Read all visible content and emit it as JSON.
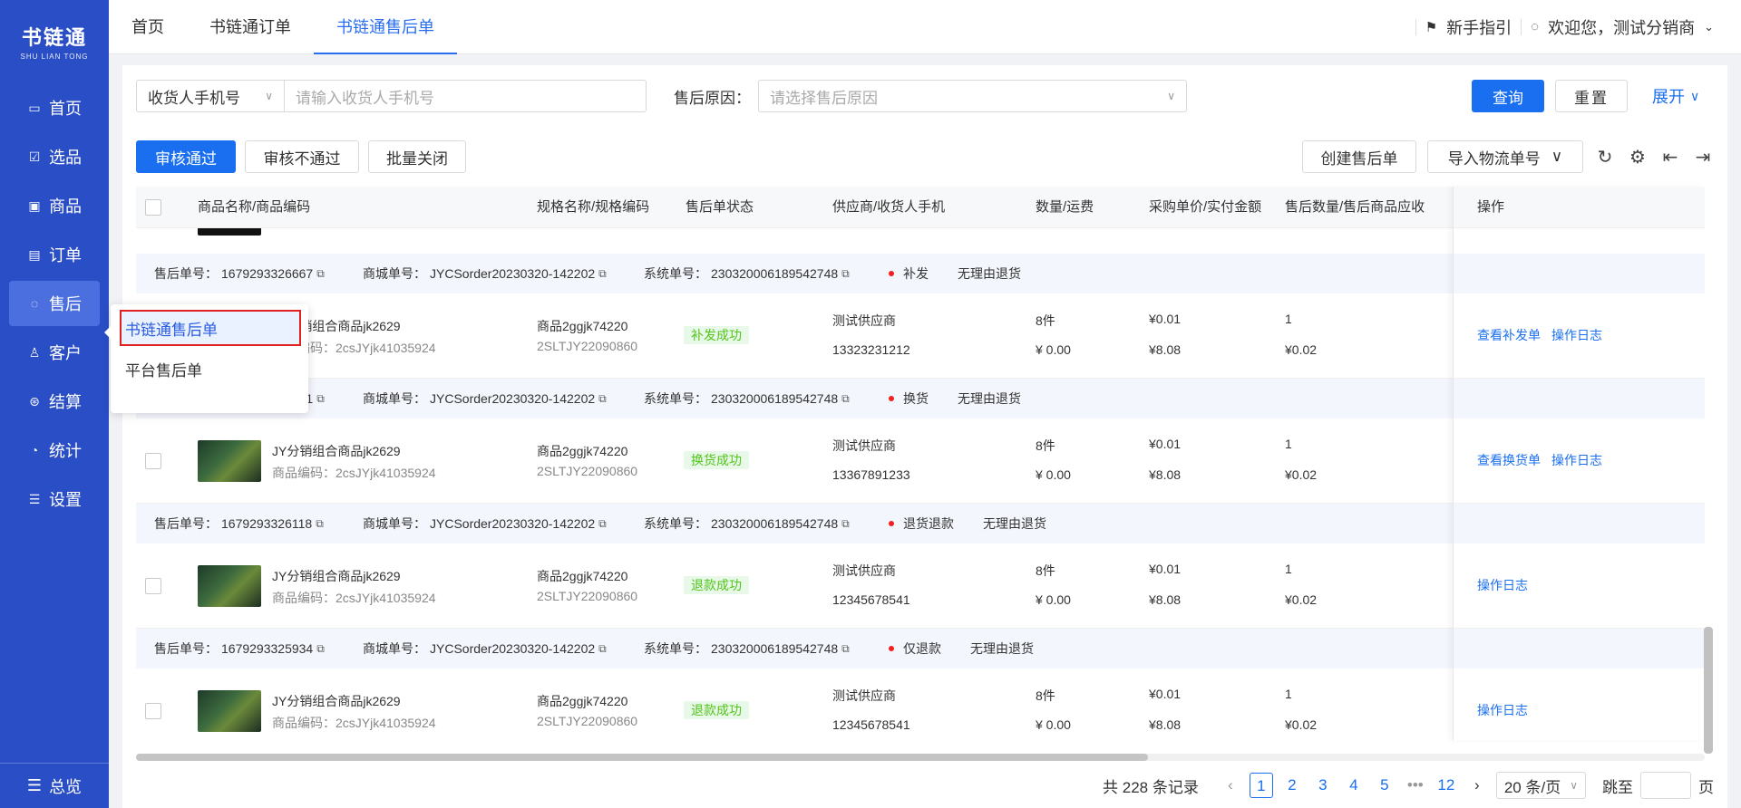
{
  "brand": {
    "name": "书链通",
    "sub": "SHU LIAN TONG"
  },
  "sidebar": {
    "items": [
      {
        "label": "首页",
        "icon": "monitor-icon"
      },
      {
        "label": "选品",
        "icon": "checklist-icon"
      },
      {
        "label": "商品",
        "icon": "box-icon"
      },
      {
        "label": "订单",
        "icon": "order-icon"
      },
      {
        "label": "售后",
        "icon": "headset-icon"
      },
      {
        "label": "客户",
        "icon": "users-icon"
      },
      {
        "label": "结算",
        "icon": "settle-icon"
      },
      {
        "label": "统计",
        "icon": "pie-icon"
      },
      {
        "label": "设置",
        "icon": "sliders-icon"
      }
    ],
    "bottom": "总览"
  },
  "flyout": {
    "items": [
      "书链通售后单",
      "平台售后单"
    ]
  },
  "topbar": {
    "tabs": [
      "首页",
      "书链通订单",
      "书链通售后单"
    ],
    "guide": "新手指引",
    "welcome": "欢迎您，测试分销商"
  },
  "filter": {
    "field_select": "收货人手机号",
    "phone_placeholder": "请输入收货人手机号",
    "reason_label": "售后原因：",
    "reason_placeholder": "请选择售后原因",
    "search": "查询",
    "reset": "重置",
    "expand": "展开"
  },
  "actions": {
    "approve": "审核通过",
    "reject": "审核不通过",
    "batch_close": "批量关闭",
    "create": "创建售后单",
    "import": "导入物流单号"
  },
  "table": {
    "headers": [
      "商品名称/商品编码",
      "规格名称/规格编码",
      "售后单状态",
      "供应商/收货人手机",
      "数量/运费",
      "采购单价/实付金额",
      "售后数量/售后商品应收",
      "操作"
    ]
  },
  "rows": [
    {
      "aftersale_label": "售后单号：",
      "aftersale_no": "1679293326667",
      "mall_label": "商城单号：",
      "mall_no": "JYCSorder20230320-142202",
      "sys_label": "系统单号：",
      "sys_no": "230320006189542748",
      "type": "补发",
      "reason": "无理由退货",
      "product": "JY分销组合商品jk2629",
      "product_code_prefix": "商品编码：",
      "product_code": "2csJYjk41035924",
      "spec": "商品2ggjk74220",
      "spec_code": "2SLTJY22090860",
      "status": "补发成功",
      "supplier": "测试供应商",
      "phone": "13323231212",
      "qty": "8件",
      "freight": "¥ 0.00",
      "unit_price": "¥0.01",
      "paid": "¥8.08",
      "as_qty": "1",
      "as_amount": "¥0.02",
      "ops": [
        "查看补发单",
        "操作日志"
      ]
    },
    {
      "aftersale_label": "售后单号：",
      "aftersale_no": "1679293326661",
      "mall_label": "商城单号：",
      "mall_no": "JYCSorder20230320-142202",
      "sys_label": "系统单号：",
      "sys_no": "230320006189542748",
      "type": "换货",
      "reason": "无理由退货",
      "product": "JY分销组合商品jk2629",
      "product_code_prefix": "商品编码：",
      "product_code": "2csJYjk41035924",
      "spec": "商品2ggjk74220",
      "spec_code": "2SLTJY22090860",
      "status": "换货成功",
      "supplier": "测试供应商",
      "phone": "13367891233",
      "qty": "8件",
      "freight": "¥ 0.00",
      "unit_price": "¥0.01",
      "paid": "¥8.08",
      "as_qty": "1",
      "as_amount": "¥0.02",
      "ops": [
        "查看换货单",
        "操作日志"
      ]
    },
    {
      "aftersale_label": "售后单号：",
      "aftersale_no": "1679293326118",
      "mall_label": "商城单号：",
      "mall_no": "JYCSorder20230320-142202",
      "sys_label": "系统单号：",
      "sys_no": "230320006189542748",
      "type": "退货退款",
      "reason": "无理由退货",
      "product": "JY分销组合商品jk2629",
      "product_code_prefix": "商品编码：",
      "product_code": "2csJYjk41035924",
      "spec": "商品2ggjk74220",
      "spec_code": "2SLTJY22090860",
      "status": "退款成功",
      "supplier": "测试供应商",
      "phone": "12345678541",
      "qty": "8件",
      "freight": "¥ 0.00",
      "unit_price": "¥0.01",
      "paid": "¥8.08",
      "as_qty": "1",
      "as_amount": "¥0.02",
      "ops": [
        "操作日志"
      ]
    },
    {
      "aftersale_label": "售后单号：",
      "aftersale_no": "1679293325934",
      "mall_label": "商城单号：",
      "mall_no": "JYCSorder20230320-142202",
      "sys_label": "系统单号：",
      "sys_no": "230320006189542748",
      "type": "仅退款",
      "reason": "无理由退货",
      "product": "JY分销组合商品jk2629",
      "product_code_prefix": "商品编码：",
      "product_code": "2csJYjk41035924",
      "spec": "商品2ggjk74220",
      "spec_code": "2SLTJY22090860",
      "status": "退款成功",
      "supplier": "测试供应商",
      "phone": "12345678541",
      "qty": "8件",
      "freight": "¥ 0.00",
      "unit_price": "¥0.01",
      "paid": "¥8.08",
      "as_qty": "1",
      "as_amount": "¥0.02",
      "ops": [
        "操作日志"
      ]
    }
  ],
  "pager": {
    "total": "共 228 条记录",
    "pages": [
      "1",
      "2",
      "3",
      "4",
      "5",
      "•••",
      "12"
    ],
    "current": "1",
    "size": "20 条/页",
    "goto": "跳至",
    "page_unit": "页"
  },
  "colors": {
    "sidebar": "#2a4ec6",
    "primary": "#1a6ff0",
    "success": "#52c41a",
    "danger": "#f02020"
  }
}
